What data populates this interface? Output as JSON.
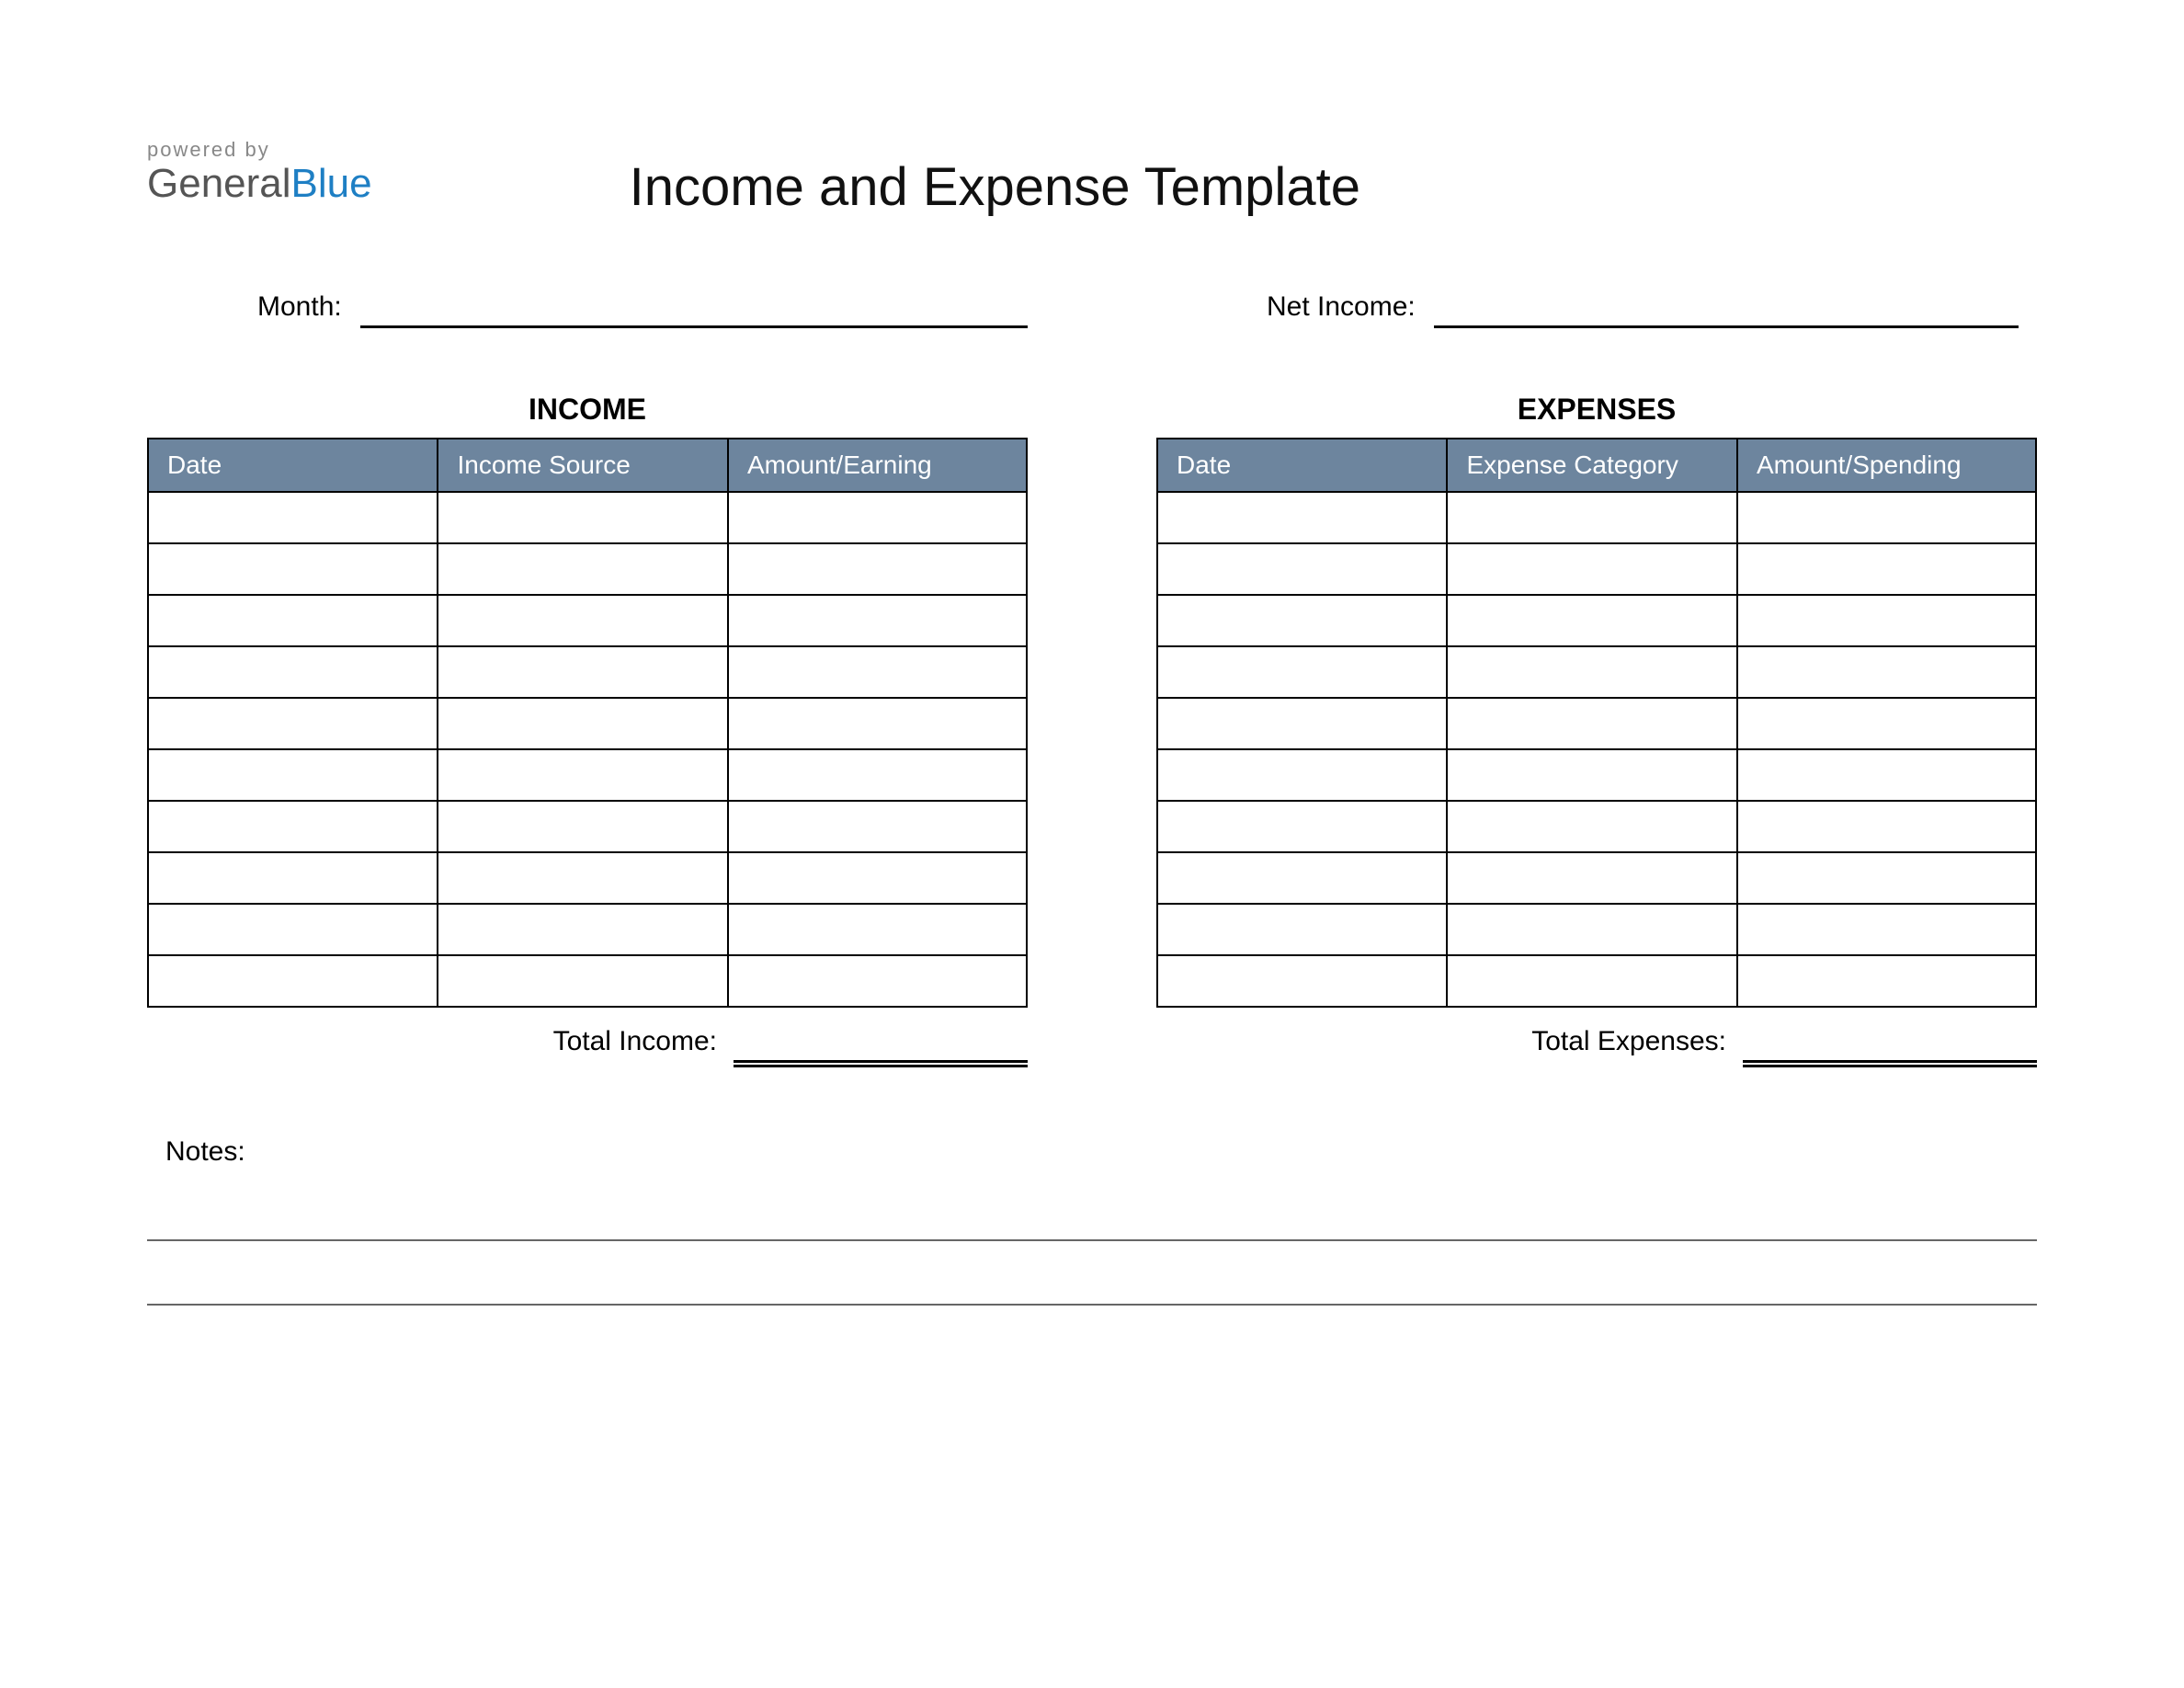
{
  "logo": {
    "powered_by": "powered by",
    "brand_general": "General",
    "brand_blue": "Blue"
  },
  "title": "Income and Expense Template",
  "fields": {
    "month_label": "Month:",
    "net_income_label": "Net Income:"
  },
  "income": {
    "section_title": "INCOME",
    "headers": {
      "date": "Date",
      "source": "Income Source",
      "amount": "Amount/Earning"
    },
    "total_label": "Total Income:",
    "row_count": 10
  },
  "expenses": {
    "section_title": "EXPENSES",
    "headers": {
      "date": "Date",
      "category": "Expense Category",
      "amount": "Amount/Spending"
    },
    "total_label": "Total Expenses:",
    "row_count": 10
  },
  "notes": {
    "label": "Notes:",
    "line_count": 2
  }
}
